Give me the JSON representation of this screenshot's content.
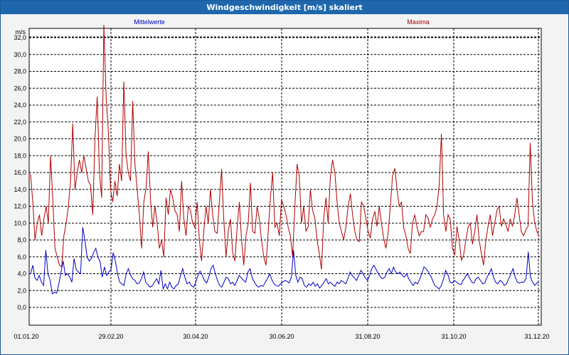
{
  "window": {
    "title": "Windgeschwindigkeit [m/s] skaliert"
  },
  "chart_data": {
    "type": "line",
    "title": "Windgeschwindigkeit [m/s] skaliert",
    "ylabel": "m/s",
    "ylim": [
      0,
      34
    ],
    "yticks": [
      "0,0",
      "2,0",
      "4,0",
      "6,0",
      "8,0",
      "10,0",
      "12,0",
      "14,0",
      "16,0",
      "18,0",
      "20,0",
      "22,0",
      "24,0",
      "26,0",
      "28,0",
      "30,0",
      "32,0"
    ],
    "xticks": [
      "01.01.20",
      "29.02.20",
      "30.04.20",
      "30.06.20",
      "31.08.20",
      "31.10.20",
      "31.12.20"
    ],
    "grid": true,
    "legend": [
      {
        "name": "Mittelwerte",
        "color": "#0000c8"
      },
      {
        "name": "Maxima",
        "color": "#b00000"
      }
    ],
    "series": [
      {
        "name": "Mittelwerte",
        "color": "#0000c8",
        "values": [
          4.0,
          5.0,
          3.5,
          3.2,
          3.8,
          3.0,
          2.6,
          6.8,
          4.0,
          3.2,
          1.6,
          1.8,
          1.7,
          2.8,
          4.2,
          5.5,
          3.8,
          4.0,
          3.6,
          3.0,
          5.8,
          4.5,
          4.2,
          4.0,
          9.5,
          8.0,
          6.0,
          5.5,
          5.8,
          6.5,
          7.0,
          6.0,
          5.4,
          3.6,
          4.8,
          3.8,
          4.2,
          4.5,
          6.5,
          5.5,
          4.0,
          3.0,
          2.8,
          2.6,
          4.0,
          4.6,
          3.8,
          3.4,
          3.2,
          2.8,
          2.9,
          3.4,
          4.2,
          3.0,
          2.7,
          2.4,
          2.6,
          3.0,
          3.4,
          2.8,
          4.4,
          2.2,
          2.8,
          2.2,
          3.0,
          2.4,
          2.2,
          2.6,
          2.8,
          3.8,
          4.6,
          3.6,
          2.8,
          3.0,
          2.6,
          2.4,
          3.0,
          3.8,
          4.3,
          3.8,
          3.2,
          2.9,
          3.6,
          4.6,
          5.0,
          4.0,
          3.2,
          2.6,
          2.4,
          3.0,
          3.6,
          3.4,
          2.8,
          3.0,
          2.6,
          3.2,
          3.8,
          3.5,
          3.2,
          3.0,
          4.2,
          4.6,
          3.5,
          3.0,
          2.6,
          2.4,
          2.6,
          2.5,
          3.0,
          3.4,
          4.0,
          3.3,
          2.8,
          2.6,
          2.5,
          2.8,
          3.0,
          3.2,
          3.1,
          2.9,
          3.6,
          6.8,
          3.8,
          3.0,
          3.6,
          3.4,
          2.6,
          2.4,
          2.8,
          2.6,
          3.0,
          2.5,
          2.8,
          2.3,
          2.6,
          3.0,
          3.4,
          2.8,
          3.0,
          2.7,
          2.5,
          3.0,
          2.8,
          3.2,
          3.0,
          2.8,
          3.4,
          4.2,
          3.8,
          3.5,
          3.2,
          3.8,
          4.4,
          4.0,
          3.5,
          3.2,
          3.8,
          4.6,
          5.0,
          4.5,
          4.0,
          3.6,
          3.4,
          3.6,
          4.2,
          4.6,
          4.0,
          4.8,
          4.2,
          4.0,
          4.2,
          3.8,
          3.6,
          4.0,
          3.4,
          3.0,
          2.6,
          3.0,
          2.8,
          3.3,
          4.0,
          4.8,
          4.6,
          4.2,
          3.8,
          3.2,
          2.6,
          2.4,
          2.2,
          2.6,
          3.4,
          4.4,
          3.9,
          3.0,
          2.9,
          3.2,
          3.0,
          2.8,
          2.7,
          3.2,
          3.6,
          4.0,
          3.5,
          3.0,
          2.9,
          3.4,
          3.6,
          3.2,
          2.8,
          2.9,
          3.6,
          4.0,
          4.6,
          3.6,
          3.0,
          2.8,
          3.2,
          3.0,
          2.6,
          2.8,
          3.4,
          4.0,
          4.6,
          3.6,
          3.0,
          2.9,
          3.0,
          3.0,
          3.4,
          6.6,
          3.6,
          3.0,
          2.6,
          2.9,
          3.0
        ]
      },
      {
        "name": "Maxima",
        "color": "#b00000",
        "values": [
          15.8,
          12.5,
          8.0,
          10.0,
          11.0,
          8.5,
          10.5,
          12.0,
          10.0,
          18.0,
          12.8,
          7.0,
          6.0,
          5.0,
          4.8,
          8.5,
          10.0,
          12.0,
          15.0,
          21.8,
          14.0,
          16.0,
          17.5,
          16.0,
          18.0,
          16.5,
          15.0,
          14.5,
          11.0,
          20.0,
          25.0,
          16.0,
          13.0,
          33.5,
          25.0,
          21.0,
          14.0,
          12.5,
          15.0,
          13.2,
          17.0,
          15.0,
          26.8,
          18.0,
          16.0,
          15.0,
          24.5,
          17.0,
          14.0,
          11.0,
          7.0,
          12.5,
          14.2,
          18.5,
          12.8,
          9.5,
          12.0,
          10.0,
          7.0,
          8.0,
          6.0,
          13.0,
          11.0,
          14.0,
          13.0,
          11.5,
          11.0,
          9.0,
          15.0,
          10.6,
          8.5,
          12.0,
          11.5,
          10.0,
          9.5,
          12.5,
          8.0,
          5.5,
          9.0,
          12.0,
          10.0,
          14.0,
          11.0,
          9.0,
          8.8,
          12.5,
          16.4,
          10.5,
          6.0,
          9.0,
          10.5,
          6.5,
          5.5,
          9.5,
          12.5,
          8.0,
          5.0,
          8.5,
          10.0,
          14.8,
          9.0,
          8.8,
          12.0,
          10.5,
          8.0,
          6.0,
          5.0,
          9.0,
          13.0,
          16.0,
          9.5,
          10.0,
          8.5,
          12.8,
          12.0,
          11.0,
          9.5,
          8.5,
          6.0,
          12.0,
          17.0,
          15.5,
          10.0,
          12.0,
          9.0,
          9.6,
          14.0,
          11.5,
          10.6,
          8.0,
          6.4,
          4.5,
          10.5,
          13.0,
          10.0,
          15.5,
          17.5,
          16.0,
          12.5,
          10.0,
          9.0,
          8.0,
          9.6,
          12.0,
          13.5,
          11.0,
          9.0,
          8.0,
          7.8,
          12.5,
          12.0,
          10.5,
          9.0,
          8.2,
          10.5,
          11.4,
          9.6,
          12.0,
          10.0,
          8.2,
          7.0,
          8.8,
          12.0,
          15.6,
          16.5,
          14.0,
          12.0,
          12.5,
          9.5,
          8.5,
          7.0,
          6.4,
          10.0,
          11.0,
          9.5,
          8.5,
          9.0,
          9.0,
          11.0,
          10.6,
          9.5,
          10.5,
          11.0,
          12.0,
          14.5,
          20.6,
          11.0,
          9.0,
          11.0,
          10.4,
          7.0,
          6.2,
          9.6,
          8.0,
          5.6,
          6.2,
          8.0,
          9.5,
          10.0,
          7.5,
          9.0,
          11.0,
          8.0,
          6.4,
          5.0,
          8.0,
          9.6,
          11.0,
          8.5,
          10.0,
          11.5,
          12.0,
          9.6,
          10.5,
          9.8,
          9.0,
          10.5,
          9.6,
          11.0,
          13.0,
          11.0,
          9.0,
          8.5,
          9.2,
          9.6,
          19.5,
          12.5,
          10.0,
          9.0,
          8.4
        ]
      }
    ]
  }
}
